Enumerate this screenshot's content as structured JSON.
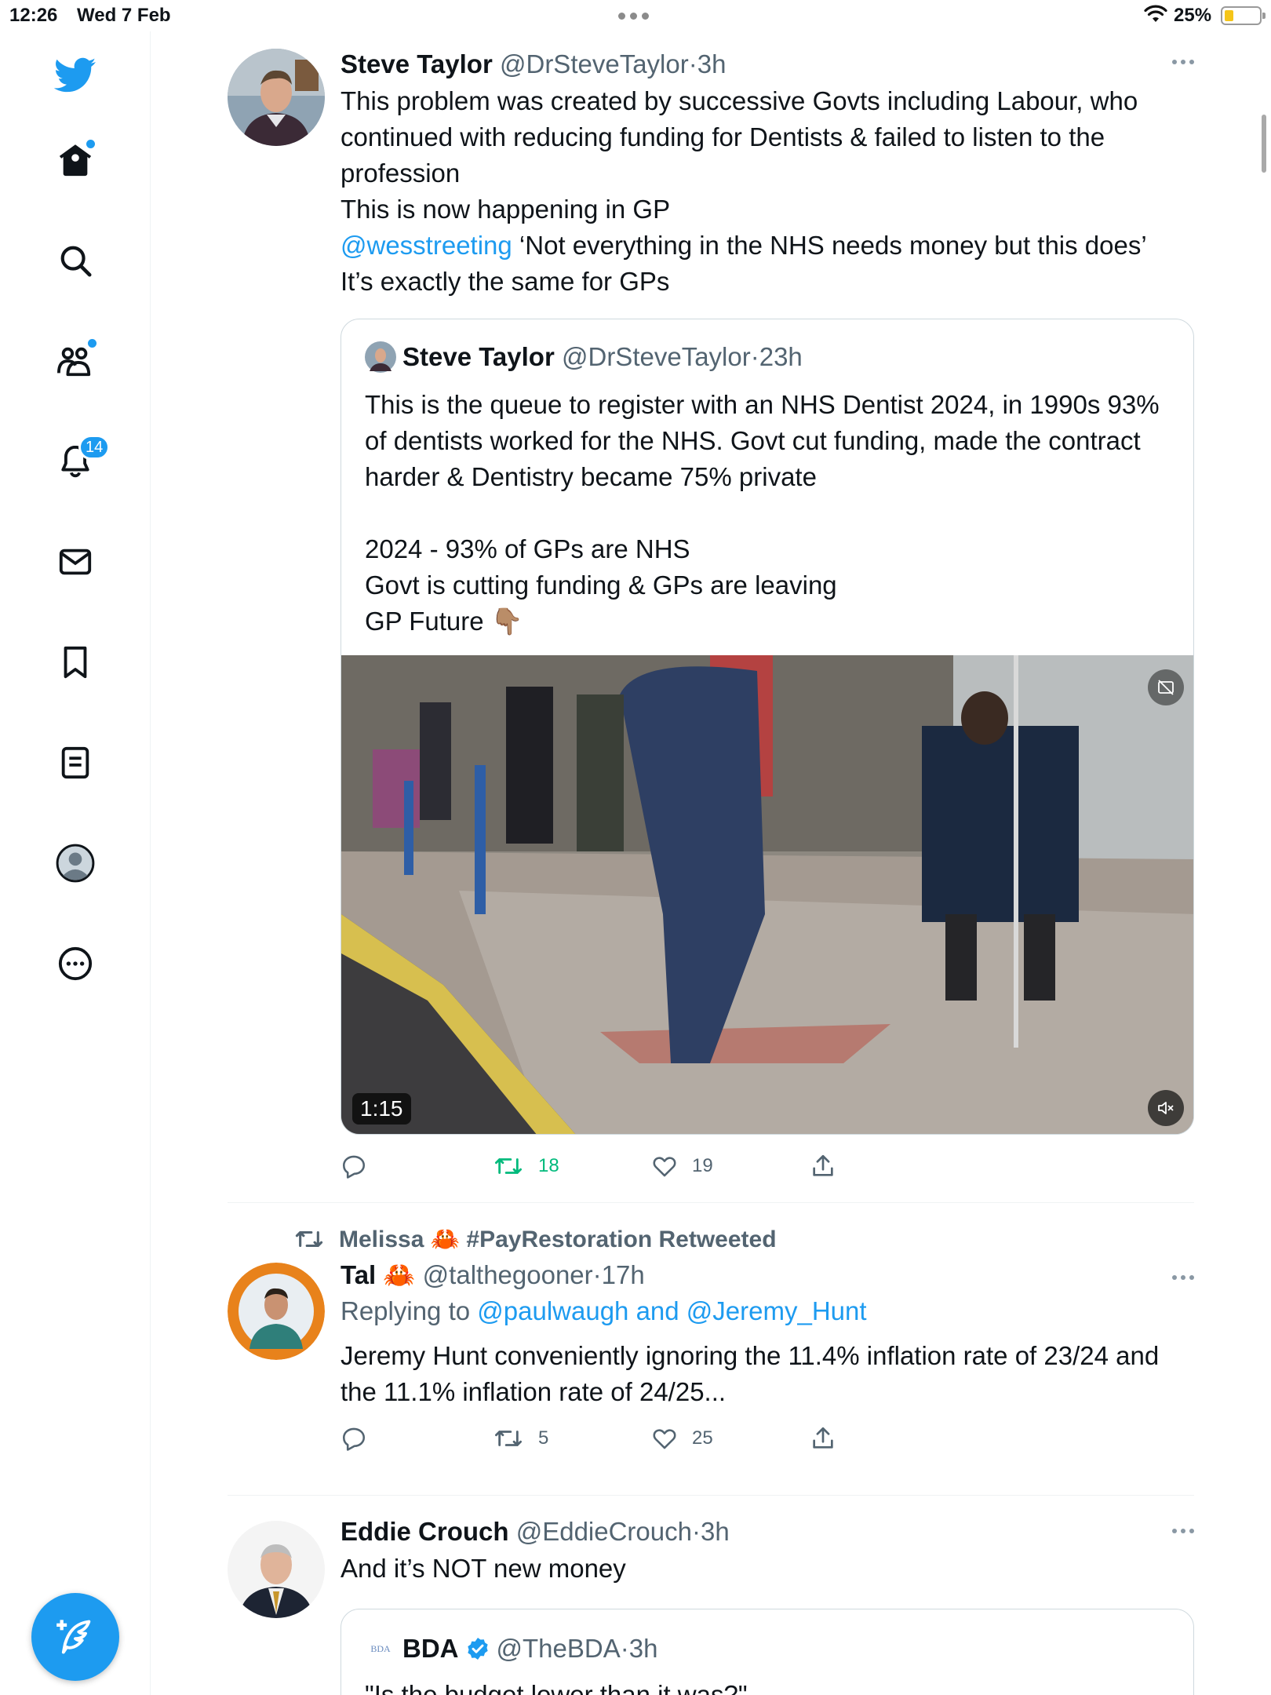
{
  "status": {
    "time": "12:26",
    "date": "Wed 7 Feb",
    "battery": "25%"
  },
  "sidebar": {
    "items": [
      {
        "name": "home"
      },
      {
        "name": "explore"
      },
      {
        "name": "communities"
      },
      {
        "name": "notifications"
      },
      {
        "name": "messages"
      },
      {
        "name": "bookmarks"
      },
      {
        "name": "lists"
      },
      {
        "name": "profile"
      },
      {
        "name": "more"
      }
    ],
    "notifications_badge": "14"
  },
  "tweets": [
    {
      "name": "Steve Taylor",
      "handle": "@DrSteveTaylor",
      "sep": "·",
      "time": "3h",
      "text_1": "This problem was created by successive Govts including Labour, who continued with reducing funding for Dentists & failed to listen to the profession\nThis is now happening in GP\n",
      "mention": "@wesstreeting",
      "text_2": " ‘Not everything in the NHS needs money but this does’\nIt’s exactly the same for GPs",
      "quote": {
        "name": "Steve Taylor",
        "handle": "@DrSteveTaylor",
        "sep": "·",
        "time": "23h",
        "text": "This is the queue to register with an NHS Dentist 2024, in 1990s 93% of dentists worked for the NHS. Govt cut funding, made the contract harder & Dentistry became 75% private\n\n2024 - 93% of GPs are NHS\nGovt is cutting funding & GPs are leaving\nGP Future 👇🏽",
        "video_duration": "1:15"
      },
      "retweets": "18",
      "likes": "19"
    },
    {
      "retweeted_by": "Melissa 🦀 #PayRestoration Retweeted",
      "name": "Tal 🦀",
      "handle": "@talthegooner",
      "sep": "·",
      "time": "17h",
      "replying_prefix": "Replying to ",
      "replying_to": "@paulwaugh and @Jeremy_Hunt",
      "text": "Jeremy Hunt conveniently ignoring the 11.4% inflation rate of 23/24 and the 11.1% inflation rate of 24/25...",
      "retweets": "5",
      "likes": "25"
    },
    {
      "name": "Eddie Crouch",
      "handle": "@EddieCrouch",
      "sep": "·",
      "time": "3h",
      "text": "And it’s NOT new money",
      "quote": {
        "logo_text": "BDA",
        "name": "BDA",
        "handle": "@TheBDA",
        "sep": "·",
        "time": "3h",
        "text": "\"Is the budget lower than it was?\""
      }
    }
  ],
  "colors": {
    "accent": "#1d9bf0",
    "retweet_green": "#00ba7c",
    "muted": "#536471"
  }
}
